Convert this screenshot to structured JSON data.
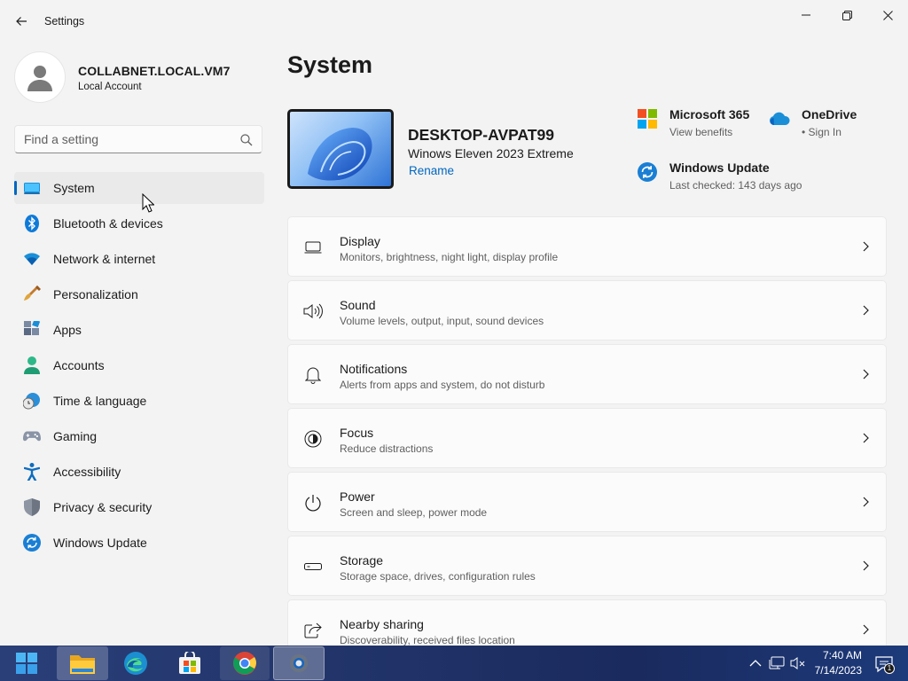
{
  "window": {
    "title": "Settings"
  },
  "profile": {
    "name": "COLLABNET.LOCAL.VM7",
    "account_type": "Local Account"
  },
  "search": {
    "placeholder": "Find a setting"
  },
  "sidebar": {
    "items": [
      {
        "label": "System",
        "icon": "system-icon",
        "active": true
      },
      {
        "label": "Bluetooth & devices",
        "icon": "bluetooth-icon"
      },
      {
        "label": "Network & internet",
        "icon": "wifi-icon"
      },
      {
        "label": "Personalization",
        "icon": "brush-icon"
      },
      {
        "label": "Apps",
        "icon": "apps-icon"
      },
      {
        "label": "Accounts",
        "icon": "person-icon"
      },
      {
        "label": "Time & language",
        "icon": "globe-clock-icon"
      },
      {
        "label": "Gaming",
        "icon": "gamepad-icon"
      },
      {
        "label": "Accessibility",
        "icon": "accessibility-icon"
      },
      {
        "label": "Privacy & security",
        "icon": "shield-icon"
      },
      {
        "label": "Windows Update",
        "icon": "update-icon"
      }
    ]
  },
  "main": {
    "title": "System",
    "device": {
      "name": "DESKTOP-AVPAT99",
      "model": "Winows Eleven 2023 Extreme",
      "rename_label": "Rename"
    },
    "tiles": {
      "ms365": {
        "title": "Microsoft 365",
        "subtitle": "View benefits"
      },
      "onedrive": {
        "title": "OneDrive",
        "subtitle": "• Sign In"
      },
      "windows_update": {
        "title": "Windows Update",
        "subtitle": "Last checked: 143 days ago"
      }
    },
    "cards": [
      {
        "title": "Display",
        "subtitle": "Monitors, brightness, night light, display profile",
        "icon": "display-icon"
      },
      {
        "title": "Sound",
        "subtitle": "Volume levels, output, input, sound devices",
        "icon": "speaker-icon"
      },
      {
        "title": "Notifications",
        "subtitle": "Alerts from apps and system, do not disturb",
        "icon": "bell-icon"
      },
      {
        "title": "Focus",
        "subtitle": "Reduce distractions",
        "icon": "focus-icon"
      },
      {
        "title": "Power",
        "subtitle": "Screen and sleep, power mode",
        "icon": "power-icon"
      },
      {
        "title": "Storage",
        "subtitle": "Storage space, drives, configuration rules",
        "icon": "storage-icon"
      },
      {
        "title": "Nearby sharing",
        "subtitle": "Discoverability, received files location",
        "icon": "share-icon"
      }
    ]
  },
  "taskbar": {
    "time": "7:40 AM",
    "date": "7/14/2023",
    "notification_count": "1"
  },
  "colors": {
    "accent": "#0067c0",
    "background": "#f3f3f3",
    "card": "#fbfbfb",
    "taskbar": "#22356b"
  }
}
